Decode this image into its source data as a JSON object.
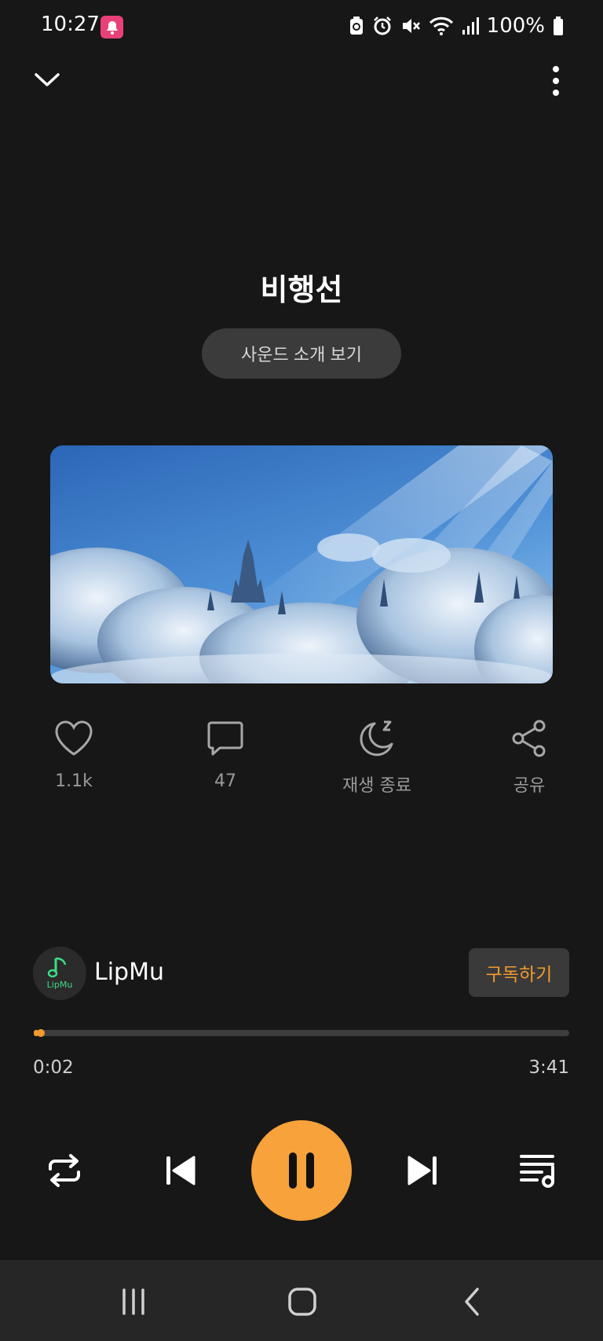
{
  "status_bar": {
    "time": "10:27",
    "battery_percent": "100%",
    "icons": [
      "notification-bell-icon",
      "battery-saver-icon",
      "alarm-icon",
      "mute-icon",
      "wifi-icon",
      "signal-icon",
      "battery-icon"
    ]
  },
  "track": {
    "title": "비행선",
    "intro_button": "사운드 소개 보기"
  },
  "actions": [
    {
      "icon": "heart-icon",
      "label": "1.1k"
    },
    {
      "icon": "comment-icon",
      "label": "47"
    },
    {
      "icon": "sleep-timer-icon",
      "label": "재생 종료"
    },
    {
      "icon": "share-icon",
      "label": "공유"
    }
  ],
  "channel": {
    "name": "LipMu",
    "avatar_text": "LipMu",
    "subscribe_label": "구독하기"
  },
  "progress": {
    "elapsed": "0:02",
    "duration": "3:41",
    "fraction": 0.009
  },
  "controls": [
    "repeat-icon",
    "previous-icon",
    "pause-icon",
    "next-icon",
    "playlist-icon"
  ],
  "colors": {
    "background": "#171717",
    "accent": "#f7a23a",
    "subscribe_text": "#f39a2e",
    "bell_badge": "#e8417a"
  }
}
